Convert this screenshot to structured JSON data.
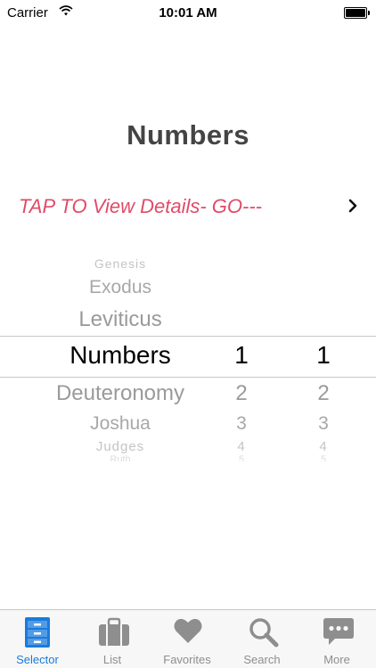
{
  "status_bar": {
    "carrier": "Carrier",
    "time": "10:01 AM"
  },
  "title": "Numbers",
  "tap_row": {
    "text": "TAP TO View Details- GO---"
  },
  "picker": {
    "books": [
      "Genesis",
      "Exodus",
      "Leviticus",
      "Numbers",
      "Deuteronomy",
      "Joshua",
      "Judges",
      "Ruth"
    ],
    "chapters": [
      "1",
      "2",
      "3",
      "4",
      "5"
    ],
    "verses": [
      "1",
      "2",
      "3",
      "4",
      "5"
    ],
    "selected": {
      "book": "Numbers",
      "chapter": "1",
      "verse": "1"
    }
  },
  "tabs": [
    {
      "label": "Selector",
      "icon": "filing-cabinet-icon",
      "active": true
    },
    {
      "label": "List",
      "icon": "briefcase-icon",
      "active": false
    },
    {
      "label": "Favorites",
      "icon": "heart-icon",
      "active": false
    },
    {
      "label": "Search",
      "icon": "search-icon",
      "active": false
    },
    {
      "label": "More",
      "icon": "speech-bubble-icon",
      "active": false
    }
  ],
  "colors": {
    "accent": "#1a7bdc",
    "tap_text": "#e04b68",
    "title": "#444444",
    "inactive": "#8e8e8e"
  }
}
